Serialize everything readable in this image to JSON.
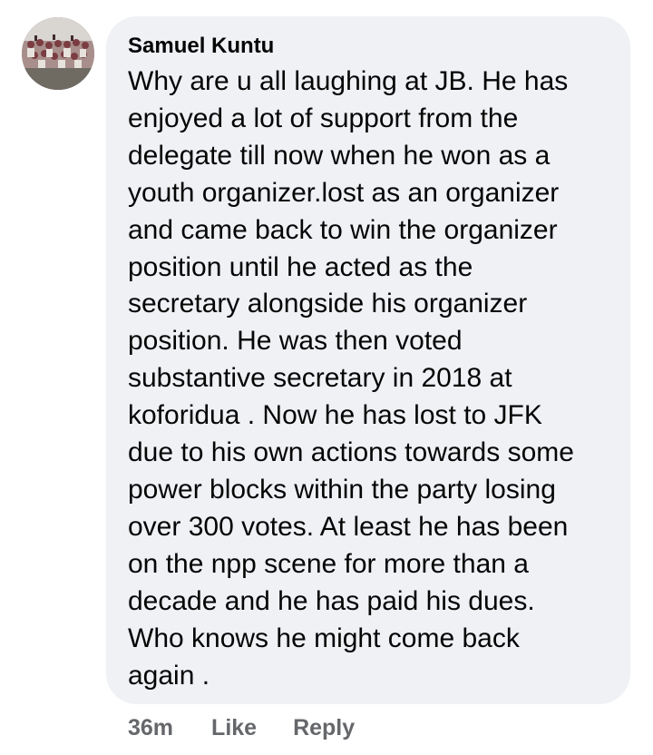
{
  "comment": {
    "author": "Samuel Kuntu",
    "text": "Why are u all laughing at JB. He has\nenjoyed a lot of support from the\ndelegate till now when he won as a\nyouth organizer.lost as an organizer\nand came back to win the organizer\nposition until he acted as the\nsecretary alongside his organizer\nposition. He was then voted\nsubstantive secretary in 2018 at\nkoforidua . Now he has lost to JFK\ndue to his own actions towards some\npower blocks within the party losing\nover 300 votes. At least he has been\non the npp scene for more than a\ndecade and he has paid his dues.\nWho knows he might come back\nagain .",
    "avatar_icon": "profile-photo-group",
    "bubble_color": "#f0f1f5"
  },
  "actions": {
    "time": "36m",
    "like_label": "Like",
    "reply_label": "Reply"
  }
}
